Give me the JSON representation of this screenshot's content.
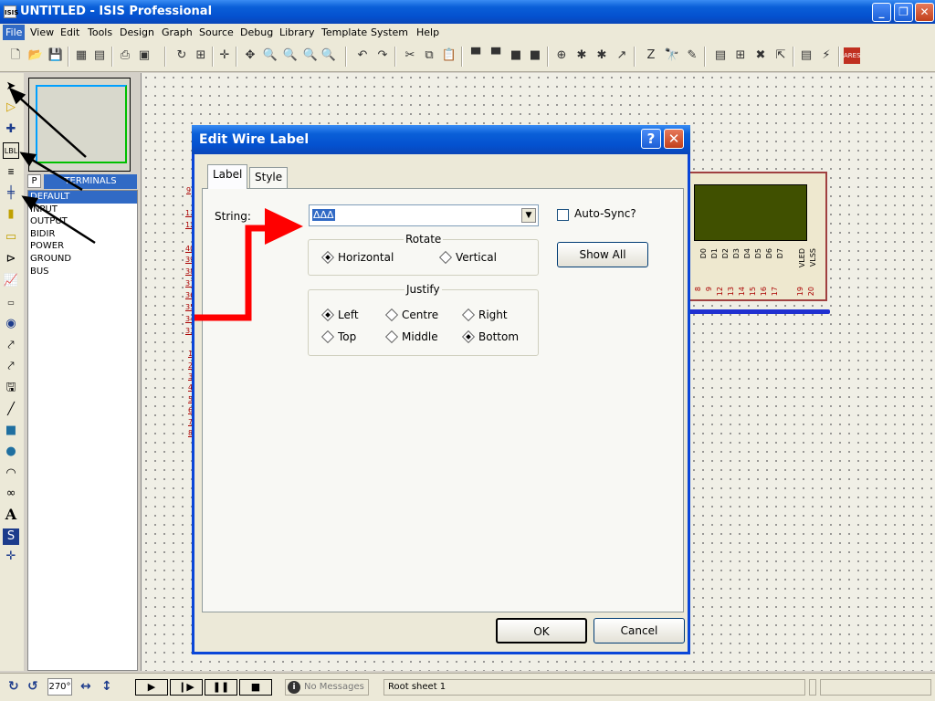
{
  "window": {
    "app_icon": "ISIS",
    "title": "UNTITLED - ISIS Professional"
  },
  "menu": [
    "File",
    "View",
    "Edit",
    "Tools",
    "Design",
    "Graph",
    "Source",
    "Debug",
    "Library",
    "Template",
    "System",
    "Help"
  ],
  "panel": {
    "selector_p": "P",
    "header": "TERMINALS",
    "terminals": [
      "DEFAULT",
      "INPUT",
      "OUTPUT",
      "BIDIR",
      "POWER",
      "GROUND",
      "BUS"
    ]
  },
  "schematic": {
    "left_pins_top": [
      "9",
      "13",
      "12",
      "40",
      "39",
      "38",
      "37",
      "36",
      "35",
      "34",
      "33"
    ],
    "left_pins_bottom": [
      "1",
      "2",
      "3",
      "4",
      "5",
      "6",
      "7",
      "8"
    ],
    "lcd_pins": [
      "D0",
      "D1",
      "D2",
      "D3",
      "D4",
      "D5",
      "D6",
      "D7",
      "VLED",
      "VLSS"
    ],
    "lcd_pin_numbers": [
      "8",
      "9",
      "12",
      "13",
      "14",
      "15",
      "16",
      "17",
      "19",
      "20"
    ]
  },
  "dialog": {
    "title": "Edit Wire Label",
    "help_btn": "?",
    "tabs": [
      "Label",
      "Style"
    ],
    "string_label": "String:",
    "string_value": "ΔΔΔ",
    "auto_sync": "Auto-Sync?",
    "show_all": "Show All",
    "rotate": {
      "title": "Rotate",
      "options": [
        "Horizontal",
        "Vertical"
      ],
      "selected": "Horizontal"
    },
    "justify": {
      "title": "Justify",
      "options": [
        "Left",
        "Centre",
        "Right",
        "Top",
        "Middle",
        "Bottom"
      ],
      "selected": [
        "Left",
        "Bottom"
      ]
    },
    "ok": "OK",
    "cancel": "Cancel"
  },
  "statusbar": {
    "rotation": "270°",
    "messages": "No Messages",
    "sheet": "Root sheet 1"
  },
  "colors": {
    "title_blue": "#0a5fd8",
    "selection": "#316ac5",
    "annotation_red": "#ff0000",
    "wire_blue": "#2030d0",
    "lcd_screen": "#405000"
  }
}
